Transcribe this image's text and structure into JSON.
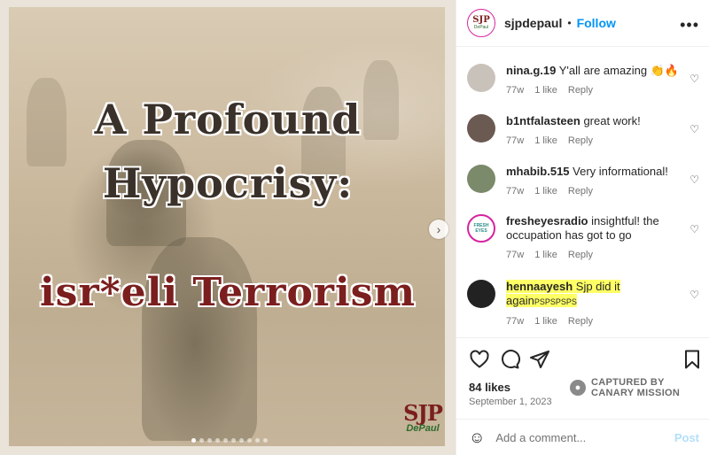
{
  "post": {
    "title_line1": "A Profound",
    "title_line2": "Hypocrisy:",
    "title_line3": "isr*eli Terrorism",
    "logo_letters": "SJP",
    "logo_sub": "DePaul",
    "carousel_dots": 10,
    "carousel_active": 0
  },
  "header": {
    "username": "sjpdepaul",
    "separator": "•",
    "follow_label": "Follow",
    "more_label": "•••",
    "avatar_letters": "SJP",
    "avatar_sub": "DePaul"
  },
  "comments": [
    {
      "user": "nina.g.19",
      "text": "Y'all are amazing 👏🔥",
      "age": "77w",
      "likes": "1 like",
      "reply": "Reply",
      "avatar_color": "#c9c2bb",
      "highlight": false
    },
    {
      "user": "b1ntfalasteen",
      "text": "great work!",
      "age": "77w",
      "likes": "1 like",
      "reply": "Reply",
      "avatar_color": "#6b5a52",
      "highlight": false
    },
    {
      "user": "mhabib.515",
      "text": "Very informational!",
      "age": "77w",
      "likes": "1 like",
      "reply": "Reply",
      "avatar_color": "#7a8a6a",
      "highlight": false
    },
    {
      "user": "fresheyesradio",
      "text": "insightful! the occupation has got to go",
      "age": "77w",
      "likes": "1 like",
      "reply": "Reply",
      "avatar_color": "#ffffff",
      "avatar_label": "FRESH EYES",
      "highlight": false
    },
    {
      "user": "hennaayesh",
      "text": "Sjp did it again",
      "text_small": "PSPSPSPS",
      "age": "77w",
      "likes": "1 like",
      "reply": "Reply",
      "avatar_color": "#222222",
      "highlight": true
    }
  ],
  "actions": {
    "likes": "84 likes",
    "date": "September 1, 2023",
    "captured_line1": "CAPTURED BY",
    "captured_line2": "CANARY MISSION"
  },
  "add_comment": {
    "placeholder": "Add a comment...",
    "post_label": "Post"
  },
  "colors": {
    "accent": "#0095f6",
    "title_red": "#7b1e1e",
    "highlight": "#ffff66"
  }
}
